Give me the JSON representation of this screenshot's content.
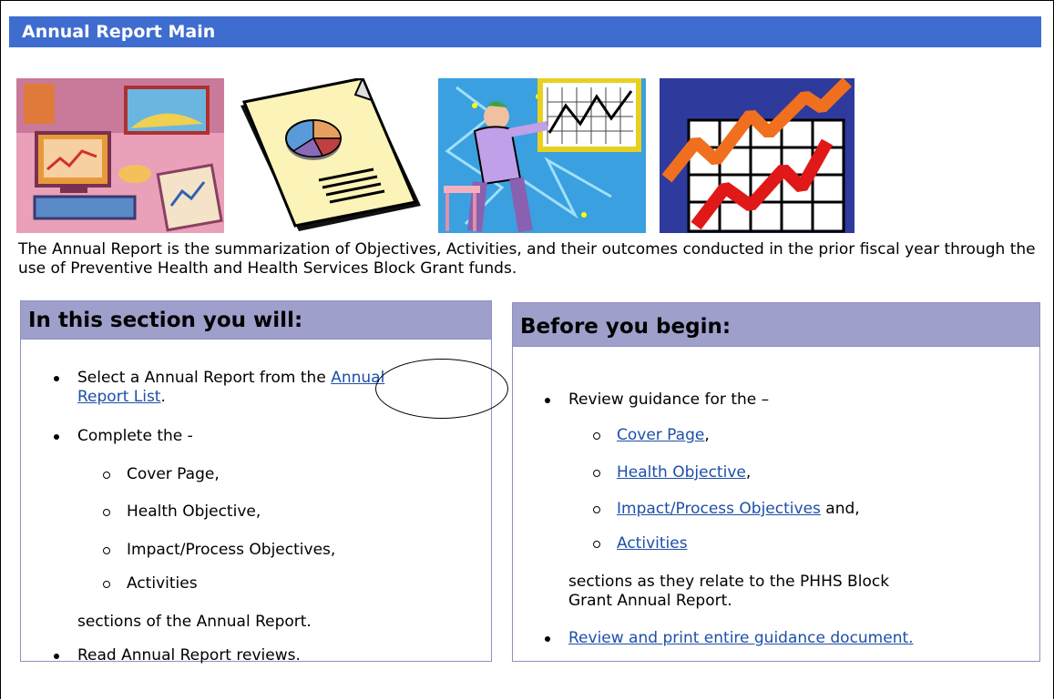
{
  "header": {
    "title": "Annual Report Main"
  },
  "intro_text": "The Annual Report is the summarization of Objectives, Activities, and their outcomes conducted in the prior fiscal year through the use of Preventive Health and Health Services Block Grant funds.",
  "left_panel": {
    "heading": "In this section you will:",
    "item1_text": "Select a Annual Report from the ",
    "item1_link_part1": "Annual",
    "item1_link_part2": "Report List",
    "item1_suffix": ".",
    "item2_text": "Complete the -",
    "subitems": [
      "Cover Page,",
      "Health Objective,",
      "Impact/Process Objectives,",
      "Activities"
    ],
    "sections_text": "sections of the Annual Report.",
    "item3_text": "Read Annual Report reviews."
  },
  "right_panel": {
    "heading": "Before you begin:",
    "item1_text": "Review guidance for the –",
    "links": [
      "Cover Page",
      "Health Objective",
      "Impact/Process Objectives",
      "Activities"
    ],
    "link_suffixes": [
      ",",
      ",",
      " and,",
      ""
    ],
    "sections_line1": "sections as they relate to the PHHS Block",
    "sections_line2": "Grant Annual Report.",
    "print_link": "Review and print entire guidance document."
  },
  "colors": {
    "title_bar": "#3f6ccf",
    "panel_header": "#9f9fcc",
    "link": "#1d4fa8"
  },
  "icons": [
    "office-desk-clipart-icon",
    "pie-chart-document-icon",
    "presenter-chart-icon",
    "rising-graph-icon"
  ]
}
